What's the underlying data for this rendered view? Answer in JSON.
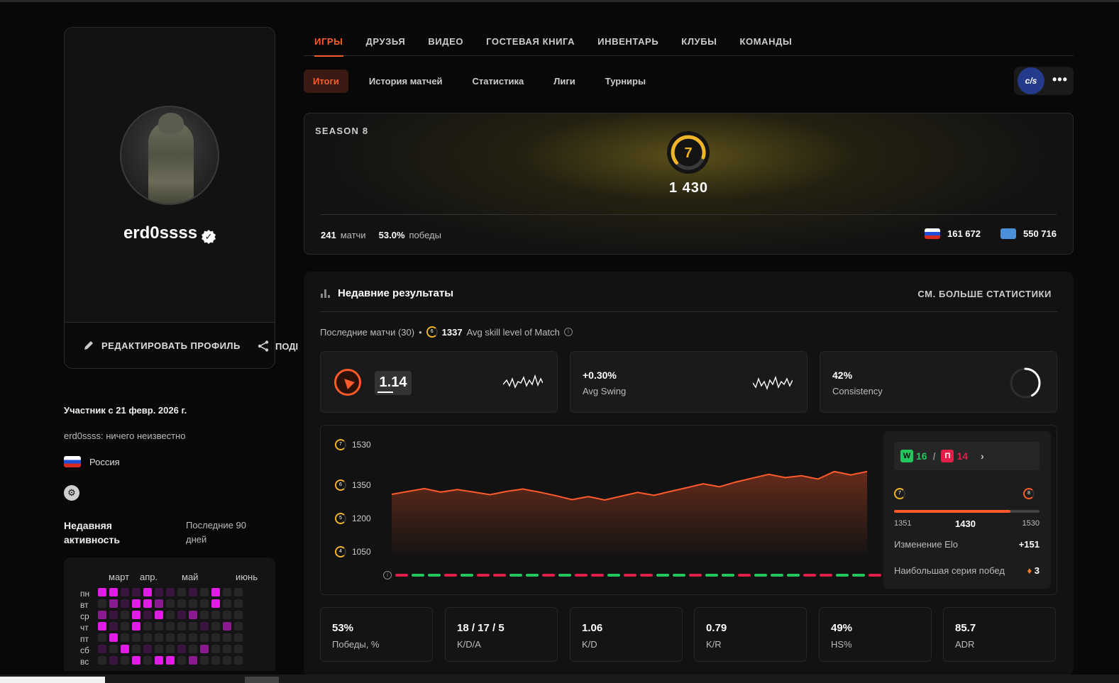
{
  "profile": {
    "username": "erd0ssss",
    "edit_label": "РЕДАКТИРОВАТЬ ПРОФИЛЬ",
    "share_label": "ПОДІ",
    "member_since": "Участник с 21 февр. 2026 г.",
    "bio": "erd0ssss: ничего неизвестно",
    "country": "Россия",
    "activity_title": "Недавняя активность",
    "activity_range": "Последние 90 дней",
    "months": [
      "март",
      "апр.",
      "май",
      "июнь"
    ],
    "days": [
      "пн",
      "вт",
      "ср",
      "чт",
      "пт",
      "сб",
      "вс"
    ]
  },
  "nav": {
    "tabs": [
      "ИГРЫ",
      "ДРУЗЬЯ",
      "ВИДЕО",
      "ГОСТЕВАЯ КНИГА",
      "ИНВЕНТАРЬ",
      "КЛУБЫ",
      "КОМАНДЫ"
    ],
    "active_tab": "ИГРЫ",
    "subtabs": [
      "Итоги",
      "История матчей",
      "Статистика",
      "Лиги",
      "Турниры"
    ],
    "active_subtab": "Итоги",
    "game_badge": "c/s",
    "more": "•••"
  },
  "season": {
    "label": "SEASON 8",
    "level": "7",
    "elo": "1 430",
    "matches": "241",
    "matches_label": "матчи",
    "winrate": "53.0%",
    "winrate_label": "победы",
    "country_rank": "161 672",
    "world_rank": "550 716"
  },
  "results": {
    "title": "Недавние результаты",
    "see_more": "СМ. БОЛЬШЕ СТАТИСТИКИ",
    "last_matches": "Последние матчи (30)",
    "avg_skill_value": "1337",
    "avg_skill_label": "Avg skill level of Match",
    "rating": "1.14",
    "avg_swing_value": "+0.30%",
    "avg_swing_label": "Avg Swing",
    "consistency_value": "42%",
    "consistency_label": "Consistency",
    "consistency_fraction": 0.42
  },
  "chart_data": {
    "type": "area",
    "ylabel_ticks": [
      {
        "value": 1530,
        "level": "7"
      },
      {
        "value": 1350,
        "level": "6"
      },
      {
        "value": 1200,
        "level": "5"
      },
      {
        "value": 1050,
        "level": "4"
      }
    ],
    "ylim": [
      1000,
      1560
    ],
    "x": [
      1,
      2,
      3,
      4,
      5,
      6,
      7,
      8,
      9,
      10,
      11,
      12,
      13,
      14,
      15,
      16,
      17,
      18,
      19,
      20,
      21,
      22,
      23,
      24,
      25,
      26,
      27,
      28,
      29,
      30
    ],
    "values": [
      1310,
      1325,
      1340,
      1322,
      1335,
      1322,
      1308,
      1325,
      1338,
      1322,
      1303,
      1282,
      1298,
      1280,
      1300,
      1320,
      1305,
      1325,
      1345,
      1365,
      1350,
      1375,
      1395,
      1415,
      1398,
      1408,
      1390,
      1430,
      1412,
      1430
    ],
    "results": [
      "L",
      "W",
      "W",
      "L",
      "W",
      "L",
      "L",
      "W",
      "W",
      "L",
      "W",
      "L",
      "L",
      "W",
      "L",
      "L",
      "W",
      "W",
      "L",
      "W",
      "W",
      "L",
      "W",
      "W",
      "W",
      "L",
      "L",
      "W",
      "W",
      "L"
    ],
    "grid": false,
    "colors": {
      "line": "#ff5a2a",
      "win": "#22c55e",
      "loss": "#e11d48"
    }
  },
  "side": {
    "wins": "16",
    "losses": "14",
    "w_label": "W",
    "l_label": "П",
    "level_from": "7",
    "level_to": "8",
    "elo_min": "1351",
    "elo_current": "1430",
    "elo_max": "1530",
    "progress_fraction": 0.8,
    "elo_change_label": "Изменение Elo",
    "elo_change": "+151",
    "streak_label": "Наибольшая серия побед",
    "streak": "3"
  },
  "tiles": [
    {
      "value": "53%",
      "label": "Победы, %"
    },
    {
      "value": "18 / 17 / 5",
      "label": "K/D/A"
    },
    {
      "value": "1.06",
      "label": "K/D"
    },
    {
      "value": "0.79",
      "label": "K/R"
    },
    {
      "value": "49%",
      "label": "HS%"
    },
    {
      "value": "85.7",
      "label": "ADR"
    }
  ],
  "heatmap_levels": [
    [
      3,
      3,
      1,
      1,
      3,
      1,
      1,
      0,
      1,
      0,
      3,
      0,
      0
    ],
    [
      0,
      2,
      1,
      3,
      3,
      2,
      0,
      0,
      0,
      0,
      3,
      0,
      0
    ],
    [
      2,
      1,
      0,
      3,
      1,
      3,
      0,
      1,
      2,
      0,
      0,
      0,
      0
    ],
    [
      3,
      1,
      0,
      3,
      0,
      0,
      0,
      0,
      0,
      1,
      0,
      2,
      0
    ],
    [
      0,
      3,
      0,
      0,
      0,
      0,
      0,
      0,
      0,
      0,
      0,
      0,
      0
    ],
    [
      1,
      0,
      3,
      0,
      1,
      0,
      0,
      1,
      0,
      2,
      0,
      0,
      0
    ],
    [
      0,
      1,
      0,
      3,
      0,
      3,
      3,
      0,
      2,
      0,
      0,
      0,
      0
    ]
  ],
  "colors": {
    "accent": "#ff5a2a",
    "level_yellow": "#f0b429",
    "heat_hi": "#e11ee8",
    "heat_mid": "#8a1a90",
    "heat_lo": "#3a153e"
  }
}
